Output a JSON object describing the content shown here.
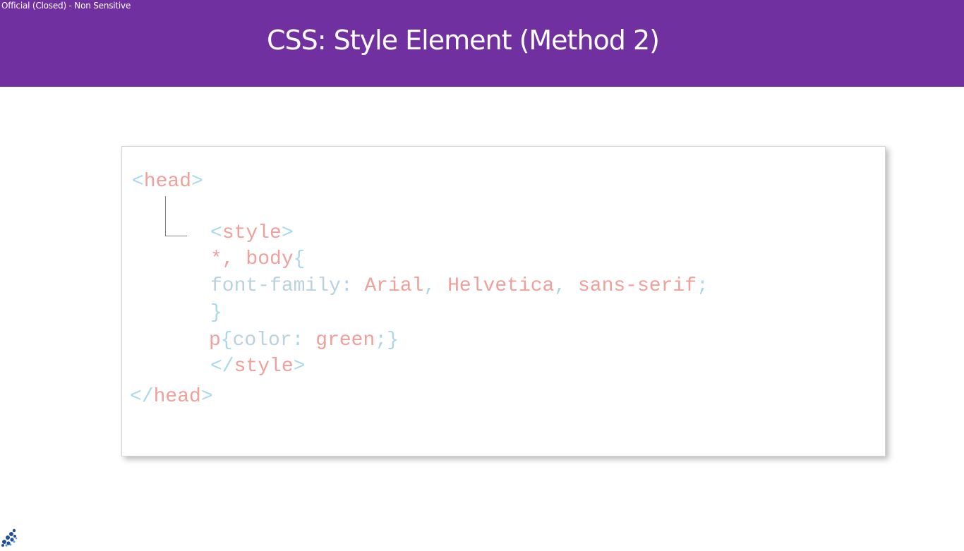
{
  "header": {
    "classification": "Official (Closed) - Non Sensitive",
    "title": "CSS: Style Element (Method 2)",
    "background_color": "#7030a0"
  },
  "code": {
    "head_open": {
      "open_bracket": "<",
      "tag": "head",
      "close_bracket": ">"
    },
    "style_open": {
      "open_bracket": "<",
      "tag": "style",
      "close_bracket": ">"
    },
    "selector_line": {
      "selector": "*, body",
      "brace": "{"
    },
    "declaration_line": {
      "property": "font-family",
      "colon": ":",
      "value_1": "Arial",
      "sep_1": ",",
      "value_2": "Helvetica",
      "sep_2": ",",
      "value_3": "sans-serif",
      "terminator": ";"
    },
    "close_brace_line": {
      "brace": "}"
    },
    "p_rule_line": {
      "selector": "p",
      "open_brace": "{",
      "property": "color",
      "colon": ":",
      "value": "green",
      "terminator": ";",
      "close_brace": "}"
    },
    "style_close": {
      "open_bracket": "</",
      "tag": "style",
      "close_bracket": ">"
    },
    "head_close": {
      "open_bracket": "</",
      "tag": "head",
      "close_bracket": ">"
    },
    "colors": {
      "bracket": "#a9d8ee",
      "keyword": "#f0a09a",
      "property": "#b9d3de"
    }
  },
  "footer": {
    "logo_icon": "institution-logo-icon"
  }
}
